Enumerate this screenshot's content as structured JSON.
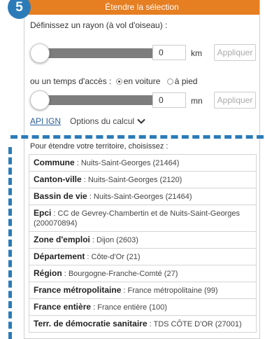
{
  "step": {
    "number": "5"
  },
  "header": {
    "title": "Étendre la sélection"
  },
  "radius": {
    "label": "Définissez un rayon (à vol d'oiseau) :",
    "value": "0",
    "unit": "km",
    "apply_label": "Appliquer"
  },
  "access": {
    "label": "ou un temps d'accès :",
    "options": [
      {
        "label": "en voiture",
        "checked": true
      },
      {
        "label": "à pied",
        "checked": false
      }
    ],
    "value": "0",
    "unit": "mn",
    "apply_label": "Appliquer"
  },
  "links": {
    "api_ign": "API IGN",
    "options_calcul": "Options du calcul"
  },
  "territory": {
    "intro": "Pour étendre votre territoire, choisissez :",
    "items": [
      {
        "type": "Commune",
        "value": "Nuits-Saint-Georges (21464)"
      },
      {
        "type": "Canton-ville",
        "value": "Nuits-Saint-Georges (2120)"
      },
      {
        "type": "Bassin de vie",
        "value": "Nuits-Saint-Georges (21464)"
      },
      {
        "type": "Epci",
        "value": "CC de Gevrey-Chambertin et de Nuits-Saint-Georges (200070894)"
      },
      {
        "type": "Zone d'emploi",
        "value": "Dijon (2603)"
      },
      {
        "type": "Département",
        "value": "Côte-d'Or (21)"
      },
      {
        "type": "Région",
        "value": "Bourgogne-Franche-Comté (27)"
      },
      {
        "type": "France métropolitaine",
        "value": "France métropolitaine (99)"
      },
      {
        "type": "France entière",
        "value": "France entière (100)"
      },
      {
        "type": "Terr. de démocratie sanitaire",
        "value": "TDS CÔTE D'OR (27001)"
      }
    ]
  },
  "colors": {
    "header": "#e67e22",
    "accent": "#2b7bb9"
  }
}
